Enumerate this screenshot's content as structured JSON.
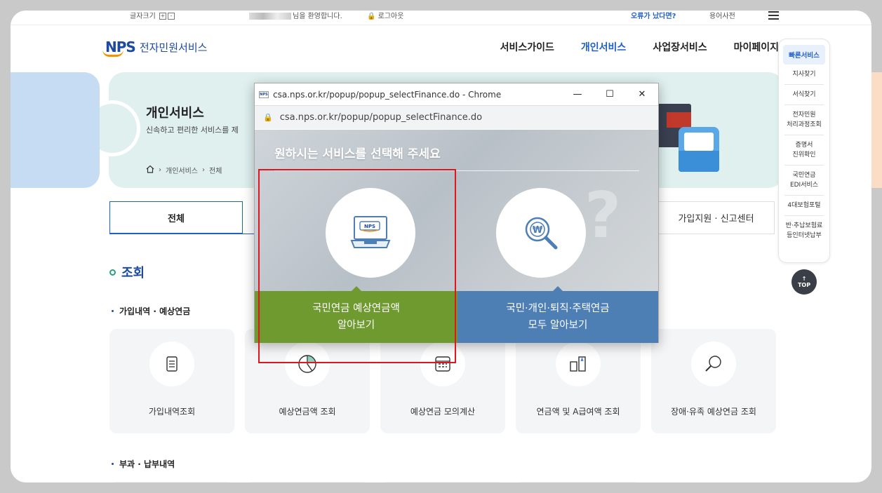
{
  "topbar": {
    "font_size_label": "글자크기",
    "plus": "+",
    "minus": "-",
    "welcome": "님을 환영합니다.",
    "logout": "로그아웃",
    "error_link": "오류가 났다면?",
    "dictionary": "용어사전"
  },
  "logo": {
    "brand": "NPS",
    "service": "전자민원서비스"
  },
  "gnb": [
    "서비스가이드",
    "개인서비스",
    "사업장서비스",
    "마이페이지"
  ],
  "hero": {
    "title": "개인서비스",
    "subtitle": "신속하고 편리한 서비스를 제",
    "breadcrumb": [
      "개인서비스",
      "전체"
    ]
  },
  "tabs": {
    "all": "전체",
    "right": "가입지원 · 신고센터"
  },
  "section": {
    "title": "조회",
    "sub1": "가입내역 · 예상연금",
    "sub2": "부과 · 납부내역"
  },
  "cards": [
    {
      "label": "가입내역조회",
      "icon": "document-icon"
    },
    {
      "label": "예상연금액 조회",
      "icon": "pie-chart-icon"
    },
    {
      "label": "예상연금 모의계산",
      "icon": "calculator-icon"
    },
    {
      "label": "연금액 및 A급여액 조회",
      "icon": "compare-icon"
    },
    {
      "label": "장애·유족 예상연금 조회",
      "icon": "search-icon"
    }
  ],
  "quick": {
    "title": "빠른서비스",
    "items": [
      [
        "지사찾기"
      ],
      [
        "서식찾기"
      ],
      [
        "전자민원",
        "처리과정조회"
      ],
      [
        "증명서",
        "진위확인"
      ],
      [
        "국민연금",
        "EDI서비스"
      ],
      [
        "4대보험포털"
      ],
      [
        "반·추납보험료",
        "등인터넷납부"
      ]
    ],
    "top": "TOP"
  },
  "popup": {
    "window_title": "csa.nps.or.kr/popup/popup_selectFinance.do - Chrome",
    "address": "csa.nps.or.kr/popup/popup_selectFinance.do",
    "headline": "원하시는 서비스를 선택해 주세요",
    "option_a": [
      "국민연금 예상연금액",
      "알아보기"
    ],
    "option_b": [
      "국민·개인·퇴직·주택연금",
      "모두 알아보기"
    ]
  },
  "colors": {
    "accent_blue": "#1f5fc8",
    "option_green": "#6e9a30",
    "option_blue": "#4d7fb5",
    "highlight_red": "#e0161e"
  }
}
